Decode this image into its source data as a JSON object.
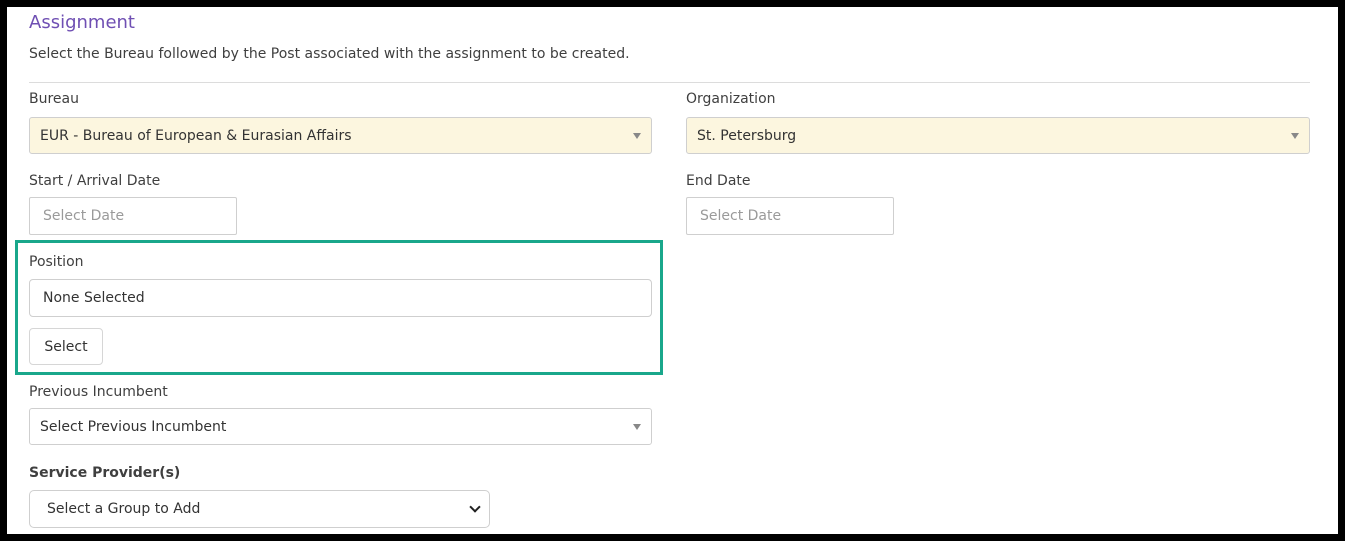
{
  "assignment": {
    "title": "Assignment",
    "description": "Select the Bureau followed by the Post associated with the assignment to be created."
  },
  "bureau": {
    "label": "Bureau",
    "value": "EUR - Bureau of European & Eurasian Affairs"
  },
  "organization": {
    "label": "Organization",
    "value": "St. Petersburg"
  },
  "start_date": {
    "label": "Start / Arrival Date",
    "placeholder": "Select Date"
  },
  "end_date": {
    "label": "End Date",
    "placeholder": "Select Date"
  },
  "position": {
    "label": "Position",
    "value": "None Selected",
    "select_label": "Select"
  },
  "previous_incumbent": {
    "label": "Previous Incumbent",
    "value": "Select Previous Incumbent"
  },
  "service_providers": {
    "label": "Service Provider(s)",
    "value": "Select a Group to Add"
  },
  "colors": {
    "title": "#6f4fb3",
    "highlight": "#19a78b",
    "filled_select_bg": "#fcf6df"
  }
}
